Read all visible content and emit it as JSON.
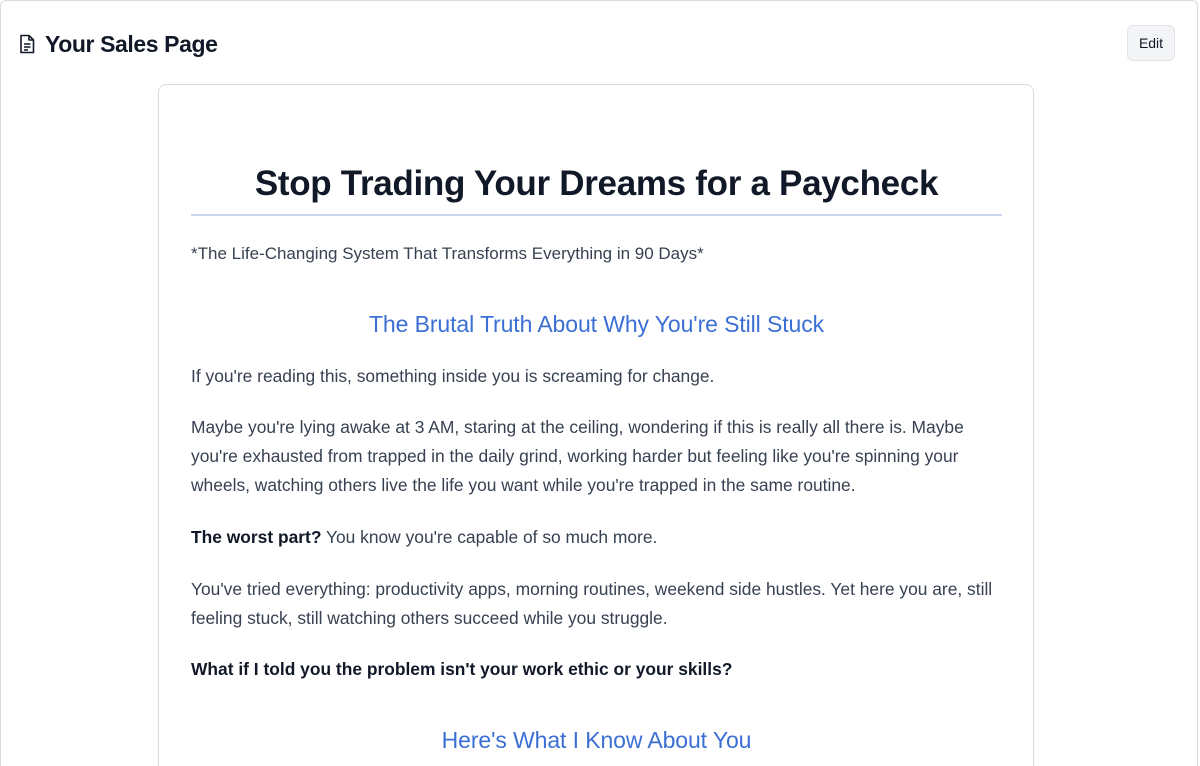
{
  "header": {
    "title": "Your Sales Page",
    "icon": "document-icon",
    "edit_label": "Edit"
  },
  "page": {
    "headline": "Stop Trading Your Dreams for a Paycheck",
    "subtitle": "*The Life-Changing System That Transforms Everything in 90 Days*",
    "section1_heading": "The Brutal Truth About Why You're Still Stuck",
    "para1": "If you're reading this, something inside you is screaming for change.",
    "para2": "Maybe you're lying awake at 3 AM, staring at the ceiling, wondering if this is really all there is. Maybe you're exhausted from trapped in the daily grind, working harder but feeling like you're spinning your wheels, watching others live the life you want while you're trapped in the same routine.",
    "para3_bold": "The worst part?",
    "para3_rest": " You know you're capable of so much more.",
    "para4": "You've tried everything: productivity apps, morning routines, weekend side hustles. Yet here you are, still feeling stuck, still watching others succeed while you struggle.",
    "para5": "What if I told you the problem isn't your work ethic or your skills?",
    "section2_heading": "Here's What I Know About You"
  },
  "colors": {
    "heading_text": "#111827",
    "body_text": "#374151",
    "section_heading": "#3b6fd4",
    "rule": "#c9d7ee"
  }
}
